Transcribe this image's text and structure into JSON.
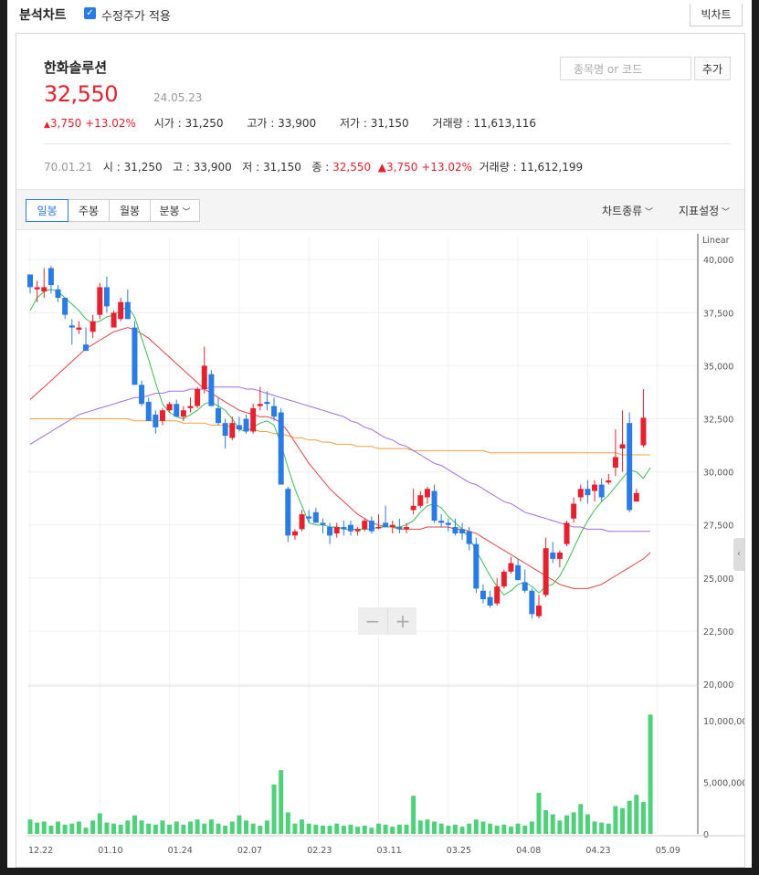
{
  "top": {
    "title": "분석차트",
    "adjust_label": "수정주가 적용",
    "big_chart_button": "빅차트"
  },
  "stock": {
    "name": "한화솔루션",
    "price": "32,550",
    "date": "24.05.23",
    "change": "3,750",
    "change_pct": "+13.02%",
    "open_label": "시가",
    "open": "31,250",
    "high_label": "고가",
    "high": "33,900",
    "low_label": "저가",
    "low": "31,150",
    "volume_label": "거래량",
    "volume": "11,613,116"
  },
  "search": {
    "placeholder": "종목명 or 코드",
    "add_button": "추가"
  },
  "cursor_row": {
    "date": "70.01.21",
    "open_label": "시",
    "open": "31,250",
    "high_label": "고",
    "high": "33,900",
    "low_label": "저",
    "low": "31,150",
    "close_label": "종",
    "close": "32,550",
    "change": "3,750",
    "change_pct": "+13.02%",
    "volume_label": "거래량",
    "volume": "11,612,199"
  },
  "tabs": {
    "daily": "일봉",
    "weekly": "주봉",
    "monthly": "월봉",
    "minute": "분봉"
  },
  "menus": {
    "chart_type": "차트종류",
    "indicator": "지표설정"
  },
  "colors": {
    "up": "#e4222f",
    "down": "#2b7be4",
    "volume": "#4fd07a",
    "ma5": "#3dbd52",
    "ma20": "#e24444",
    "ma60": "#a66be0",
    "ma120": "#f0a040"
  },
  "chart_data": {
    "type": "candlestick",
    "scale_label": "Linear",
    "ylim": [
      20000,
      41000
    ],
    "price_ticks": [
      "40,000",
      "37,500",
      "35,000",
      "32,500",
      "30,000",
      "27,500",
      "25,000",
      "22,500",
      "20,000"
    ],
    "volume_ticks": [
      "10,000,000",
      "5,000,000",
      "0"
    ],
    "x_ticks": [
      {
        "label": "12.22",
        "index": 0
      },
      {
        "label": "01.10",
        "index": 10
      },
      {
        "label": "01.24",
        "index": 20
      },
      {
        "label": "02.07",
        "index": 30
      },
      {
        "label": "02.23",
        "index": 40
      },
      {
        "label": "03.11",
        "index": 50
      },
      {
        "label": "03.25",
        "index": 60
      },
      {
        "label": "04.08",
        "index": 70
      },
      {
        "label": "04.23",
        "index": 80
      },
      {
        "label": "05.09",
        "index": 90
      }
    ],
    "candles": [
      [
        39300,
        39300,
        38400,
        38700
      ],
      [
        38600,
        39000,
        38000,
        38700
      ],
      [
        38500,
        39600,
        38200,
        38700
      ],
      [
        39600,
        39700,
        38400,
        38800
      ],
      [
        38600,
        38800,
        38000,
        38200
      ],
      [
        38200,
        38200,
        37200,
        37400
      ],
      [
        36900,
        37200,
        36000,
        36800
      ],
      [
        36700,
        37100,
        36500,
        36800
      ],
      [
        36000,
        36800,
        35800,
        35700
      ],
      [
        36600,
        37400,
        36300,
        37100
      ],
      [
        37400,
        38900,
        37200,
        38700
      ],
      [
        38700,
        39200,
        37500,
        37800
      ],
      [
        36800,
        37600,
        36900,
        37500
      ],
      [
        37200,
        38200,
        37100,
        38000
      ],
      [
        38000,
        38600,
        37500,
        37200
      ],
      [
        36800,
        37100,
        34200,
        34100
      ],
      [
        34100,
        34300,
        33100,
        33200
      ],
      [
        33300,
        33500,
        32400,
        32400
      ],
      [
        32700,
        32900,
        31800,
        32100
      ],
      [
        32400,
        33000,
        32200,
        32900
      ],
      [
        32900,
        33300,
        32800,
        33200
      ],
      [
        33200,
        33400,
        32700,
        32600
      ],
      [
        32600,
        33100,
        32400,
        32900
      ],
      [
        33000,
        33500,
        32800,
        33100
      ],
      [
        33100,
        34000,
        33000,
        33900
      ],
      [
        33900,
        35900,
        33700,
        35000
      ],
      [
        34600,
        34800,
        33100,
        33100
      ],
      [
        33000,
        33500,
        32200,
        32300
      ],
      [
        32300,
        32500,
        31100,
        31700
      ],
      [
        31600,
        32600,
        31500,
        32300
      ],
      [
        32200,
        32600,
        31900,
        32000
      ],
      [
        32500,
        32700,
        31800,
        31900
      ],
      [
        31900,
        33200,
        31800,
        33000
      ],
      [
        33100,
        34000,
        32900,
        33200
      ],
      [
        33300,
        33800,
        32900,
        33200
      ],
      [
        33100,
        33500,
        32400,
        32600
      ],
      [
        32800,
        33000,
        29500,
        29400
      ],
      [
        29200,
        29300,
        26700,
        27000
      ],
      [
        27000,
        27300,
        26800,
        27200
      ],
      [
        27300,
        28200,
        27200,
        28000
      ],
      [
        27900,
        28200,
        27600,
        27800
      ],
      [
        28100,
        28300,
        27600,
        27600
      ],
      [
        27600,
        27800,
        27100,
        27500
      ],
      [
        27400,
        27600,
        26600,
        27000
      ],
      [
        27100,
        27600,
        26900,
        27400
      ],
      [
        27400,
        27700,
        27000,
        27300
      ],
      [
        27500,
        27700,
        27000,
        27200
      ],
      [
        27200,
        27400,
        27000,
        27300
      ],
      [
        27300,
        27800,
        27200,
        27700
      ],
      [
        27700,
        27900,
        27100,
        27200
      ],
      [
        27400,
        28000,
        27300,
        27400
      ],
      [
        27600,
        28400,
        27400,
        27400
      ],
      [
        27400,
        27700,
        27100,
        27500
      ],
      [
        27400,
        27800,
        27100,
        27300
      ],
      [
        27300,
        27600,
        27100,
        27400
      ],
      [
        28200,
        29200,
        28000,
        28400
      ],
      [
        28400,
        29100,
        28300,
        28900
      ],
      [
        28800,
        29300,
        28500,
        29200
      ],
      [
        29100,
        29400,
        27600,
        27700
      ],
      [
        27700,
        28000,
        27400,
        27600
      ],
      [
        27600,
        27800,
        27200,
        27500
      ],
      [
        27400,
        27800,
        27000,
        27100
      ],
      [
        27300,
        27600,
        26800,
        27100
      ],
      [
        27200,
        27400,
        26300,
        26600
      ],
      [
        26600,
        26900,
        24300,
        24500
      ],
      [
        24400,
        24700,
        23800,
        24000
      ],
      [
        24100,
        24400,
        23600,
        23700
      ],
      [
        23800,
        25000,
        23700,
        24600
      ],
      [
        24600,
        25400,
        24500,
        25300
      ],
      [
        25300,
        26000,
        25200,
        25700
      ],
      [
        25600,
        25900,
        24900,
        24900
      ],
      [
        24800,
        25400,
        24300,
        24400
      ],
      [
        24400,
        24500,
        23100,
        23300
      ],
      [
        23200,
        24200,
        23100,
        23700
      ],
      [
        24200,
        26900,
        24100,
        26400
      ],
      [
        26200,
        26700,
        25700,
        25900
      ],
      [
        25900,
        26300,
        25500,
        26200
      ],
      [
        26600,
        27700,
        26500,
        27600
      ],
      [
        27800,
        28800,
        27600,
        28500
      ],
      [
        28800,
        29400,
        28600,
        29200
      ],
      [
        29200,
        29600,
        28500,
        28900
      ],
      [
        29100,
        29600,
        28600,
        29400
      ],
      [
        29400,
        29700,
        28600,
        28800
      ],
      [
        29500,
        29900,
        29400,
        29600
      ],
      [
        30200,
        32000,
        29800,
        30700
      ],
      [
        31100,
        32900,
        30000,
        31300
      ],
      [
        32300,
        32800,
        28100,
        28200
      ],
      [
        28600,
        29200,
        28800,
        29000
      ],
      [
        31250,
        33900,
        31150,
        32550
      ]
    ],
    "volume_millions": [
      1.4,
      1.1,
      1.2,
      0.8,
      1.2,
      0.9,
      1.0,
      1.2,
      0.6,
      1.3,
      2.0,
      1.1,
      1.0,
      0.9,
      1.3,
      1.8,
      1.3,
      1.0,
      0.9,
      1.3,
      0.9,
      1.2,
      0.9,
      1.2,
      1.4,
      1.0,
      1.4,
      1.0,
      0.8,
      1.2,
      1.8,
      1.3,
      1.0,
      0.8,
      1.3,
      4.8,
      6.2,
      2.1,
      1.0,
      1.4,
      1.0,
      0.9,
      0.8,
      0.8,
      1.0,
      0.8,
      0.9,
      0.7,
      0.8,
      0.6,
      1.0,
      0.9,
      0.7,
      0.9,
      0.9,
      3.7,
      1.3,
      1.4,
      1.2,
      1.0,
      0.8,
      0.9,
      0.7,
      1.0,
      1.4,
      1.2,
      1.0,
      0.8,
      0.9,
      0.7,
      1.0,
      0.8,
      1.2,
      4.0,
      2.3,
      1.9,
      1.3,
      1.8,
      2.1,
      2.9,
      1.9,
      1.2,
      1.1,
      1.0,
      2.7,
      2.5,
      3.2,
      3.8,
      3.1,
      11.6
    ],
    "ma5": [
      37600,
      38200,
      38500,
      38600,
      38500,
      38200,
      37900,
      37600,
      37200,
      37000,
      37100,
      37300,
      37400,
      37600,
      37800,
      37300,
      36300,
      35300,
      34200,
      33200,
      32800,
      32600,
      32500,
      32700,
      32900,
      33200,
      33300,
      33100,
      32900,
      32500,
      32000,
      31900,
      32100,
      32300,
      32400,
      32200,
      31300,
      30200,
      29200,
      28400,
      27600,
      27500,
      27500,
      27400,
      27400,
      27300,
      27300,
      27300,
      27300,
      27300,
      27400,
      27400,
      27400,
      27400,
      27500,
      27700,
      28100,
      28400,
      28500,
      28300,
      27900,
      27600,
      27300,
      26900,
      26300,
      25700,
      25100,
      24600,
      24200,
      24400,
      24700,
      24800,
      24600,
      24300,
      24600,
      24700,
      25100,
      25700,
      26400,
      27100,
      27700,
      28200,
      28600,
      28900,
      29300,
      29700,
      30100,
      30000,
      29700,
      30200
    ],
    "ma20": [
      33400,
      33700,
      34000,
      34300,
      34600,
      34900,
      35200,
      35500,
      35800,
      36000,
      36200,
      36400,
      36600,
      36700,
      36800,
      36700,
      36500,
      36300,
      36000,
      35700,
      35400,
      35100,
      34800,
      34500,
      34200,
      33900,
      33700,
      33500,
      33300,
      33100,
      32900,
      32800,
      32700,
      32600,
      32600,
      32500,
      32300,
      31900,
      31400,
      30900,
      30400,
      30000,
      29600,
      29200,
      28900,
      28600,
      28300,
      28000,
      27800,
      27600,
      27500,
      27400,
      27400,
      27300,
      27300,
      27300,
      27300,
      27400,
      27400,
      27400,
      27400,
      27300,
      27300,
      27200,
      27100,
      26900,
      26700,
      26500,
      26300,
      26100,
      25900,
      25700,
      25500,
      25300,
      25100,
      24900,
      24700,
      24600,
      24500,
      24500,
      24500,
      24600,
      24700,
      24900,
      25100,
      25300,
      25500,
      25700,
      25900,
      26200
    ],
    "ma60": [
      31300,
      31500,
      31700,
      31900,
      32100,
      32300,
      32500,
      32700,
      32800,
      32900,
      33000,
      33100,
      33200,
      33300,
      33400,
      33500,
      33500,
      33600,
      33700,
      33700,
      33800,
      33800,
      33800,
      33900,
      33900,
      33900,
      34000,
      34000,
      34000,
      34000,
      34000,
      33900,
      33900,
      33800,
      33700,
      33600,
      33500,
      33400,
      33300,
      33200,
      33100,
      33000,
      32900,
      32800,
      32700,
      32600,
      32400,
      32300,
      32100,
      32000,
      31800,
      31600,
      31500,
      31300,
      31200,
      31000,
      30800,
      30600,
      30400,
      30300,
      30100,
      29900,
      29700,
      29500,
      29400,
      29200,
      29000,
      28800,
      28600,
      28500,
      28300,
      28100,
      28000,
      27900,
      27800,
      27700,
      27600,
      27500,
      27400,
      27400,
      27300,
      27300,
      27300,
      27200,
      27200,
      27200,
      27200,
      27200,
      27200,
      27200
    ],
    "ma120": [
      32500,
      32500,
      32500,
      32500,
      32500,
      32500,
      32500,
      32500,
      32500,
      32500,
      32500,
      32500,
      32500,
      32500,
      32500,
      32400,
      32400,
      32400,
      32400,
      32400,
      32400,
      32400,
      32300,
      32300,
      32300,
      32300,
      32200,
      32200,
      32200,
      32100,
      32100,
      32000,
      32000,
      31900,
      31900,
      31800,
      31800,
      31700,
      31600,
      31600,
      31500,
      31500,
      31400,
      31400,
      31300,
      31300,
      31300,
      31200,
      31200,
      31200,
      31100,
      31100,
      31100,
      31100,
      31100,
      31000,
      31000,
      31000,
      31000,
      31000,
      31000,
      31000,
      31000,
      31000,
      31000,
      31000,
      30900,
      30900,
      30900,
      30900,
      30900,
      30900,
      30900,
      30900,
      30900,
      30900,
      30900,
      30900,
      30900,
      30900,
      30900,
      30900,
      30900,
      30900,
      30900,
      30800,
      30800,
      30800,
      30800,
      30800
    ]
  }
}
